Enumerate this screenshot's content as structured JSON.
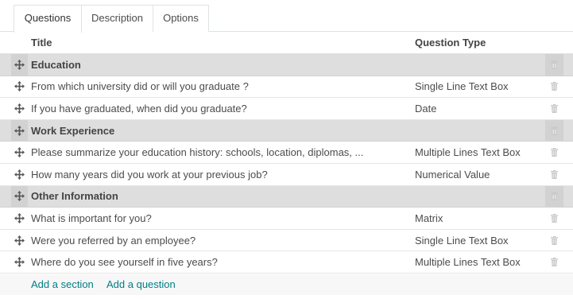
{
  "tabs": [
    {
      "label": "Questions",
      "active": true
    },
    {
      "label": "Description",
      "active": false
    },
    {
      "label": "Options",
      "active": false
    }
  ],
  "table": {
    "columns": {
      "title": "Title",
      "type": "Question Type"
    },
    "rows": [
      {
        "kind": "section",
        "title": "Education",
        "type": ""
      },
      {
        "kind": "question",
        "title": "From which university did or will you graduate ?",
        "type": "Single Line Text Box"
      },
      {
        "kind": "question",
        "title": "If you have graduated, when did you graduate?",
        "type": "Date"
      },
      {
        "kind": "section",
        "title": "Work Experience",
        "type": ""
      },
      {
        "kind": "question",
        "title": "Please summarize your education history: schools, location, diplomas, ...",
        "type": "Multiple Lines Text Box"
      },
      {
        "kind": "question",
        "title": "How many years did you work at your previous job?",
        "type": "Numerical Value"
      },
      {
        "kind": "section",
        "title": "Other Information",
        "type": ""
      },
      {
        "kind": "question",
        "title": "What is important for you?",
        "type": "Matrix"
      },
      {
        "kind": "question",
        "title": "Were you referred by an employee?",
        "type": "Single Line Text Box"
      },
      {
        "kind": "question",
        "title": "Where do you see yourself in five years?",
        "type": "Multiple Lines Text Box"
      }
    ]
  },
  "actions": {
    "add_section": "Add a section",
    "add_question": "Add a question"
  },
  "icons": {
    "handle": "move-handle-icon",
    "delete": "trash-icon"
  },
  "colors": {
    "section_bg": "#dedede",
    "link": "#017e84",
    "text": "#4c4c4c"
  }
}
